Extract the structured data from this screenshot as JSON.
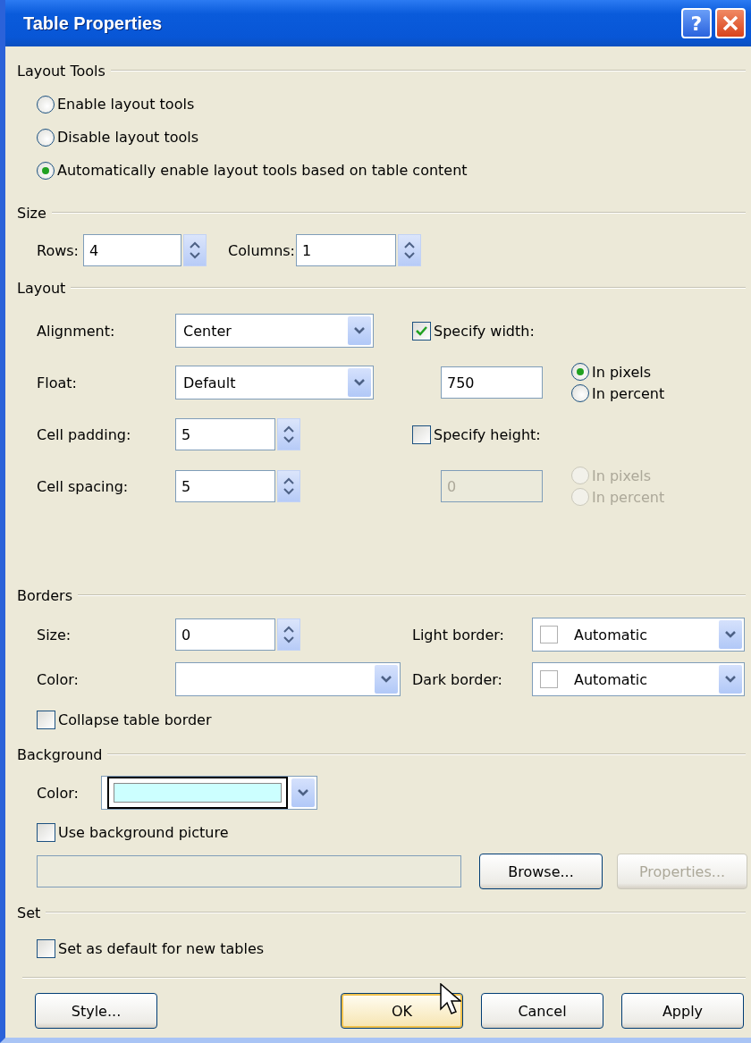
{
  "window": {
    "title": "Table Properties",
    "help": "?"
  },
  "layout_tools": {
    "heading": "Layout Tools",
    "options": [
      {
        "label": "Enable layout tools",
        "selected": false
      },
      {
        "label": "Disable layout tools",
        "selected": false
      },
      {
        "label": "Automatically enable layout tools based on table content",
        "selected": true
      }
    ]
  },
  "size": {
    "heading": "Size",
    "rows": {
      "label": "Rows:",
      "value": "4"
    },
    "columns": {
      "label": "Columns:",
      "value": "1"
    }
  },
  "layout": {
    "heading": "Layout",
    "alignment": {
      "label": "Alignment:",
      "value": "Center"
    },
    "float": {
      "label": "Float:",
      "value": "Default"
    },
    "cell_padding": {
      "label": "Cell padding:",
      "value": "5"
    },
    "cell_spacing": {
      "label": "Cell spacing:",
      "value": "5"
    },
    "specify_width": {
      "label": "Specify width:",
      "checked": true,
      "value": "750",
      "disabled": false,
      "units": [
        {
          "label": "In pixels",
          "selected": true
        },
        {
          "label": "In percent",
          "selected": false
        }
      ]
    },
    "specify_height": {
      "label": "Specify height:",
      "checked": false,
      "value": "0",
      "disabled": true,
      "units": [
        {
          "label": "In pixels",
          "selected": false
        },
        {
          "label": "In percent",
          "selected": false
        }
      ]
    }
  },
  "borders": {
    "heading": "Borders",
    "size": {
      "label": "Size:",
      "value": "0"
    },
    "color": {
      "label": "Color:"
    },
    "light_border": {
      "label": "Light border:",
      "value": "Automatic"
    },
    "dark_border": {
      "label": "Dark border:",
      "value": "Automatic"
    },
    "collapse": {
      "label": "Collapse table border",
      "checked": false
    }
  },
  "background": {
    "heading": "Background",
    "color": {
      "label": "Color:",
      "color": "#ccffff"
    },
    "use_picture": {
      "label": "Use background picture",
      "checked": false
    },
    "browse": {
      "label": "Browse...",
      "disabled": false
    },
    "properties": {
      "label": "Properties...",
      "disabled": true
    }
  },
  "set": {
    "heading": "Set",
    "default": {
      "label": "Set as default for new tables",
      "checked": false
    }
  },
  "buttons": [
    {
      "label": "Style...",
      "default": false
    },
    {
      "label": "OK",
      "default": true
    },
    {
      "label": "Cancel",
      "default": false
    },
    {
      "label": "Apply",
      "default": false
    }
  ]
}
